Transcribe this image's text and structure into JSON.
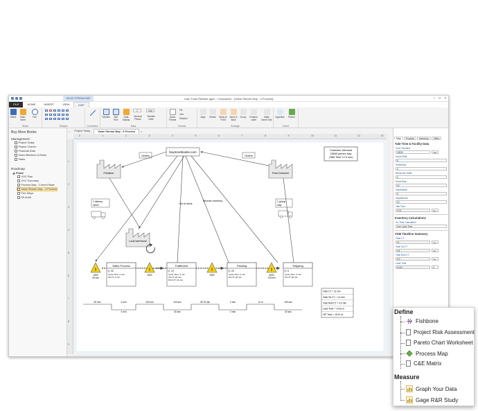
{
  "window": {
    "title": "Lean Tools Release.qgxo - Companion - [Value Stream Map - 4 Process]",
    "context_tab": "VALUE STREAM MAP",
    "controls": [
      "–",
      "□",
      "×"
    ],
    "help": "?"
  },
  "ribbon_tabs": [
    "FILE",
    "HOME",
    "INSERT",
    "VIEW",
    "MAP"
  ],
  "ribbon": {
    "mode": {
      "label": "Mode",
      "buttons": [
        "Select",
        "Multi-Insert",
        "Pan"
      ]
    },
    "shapes": {
      "label": "Shapes"
    },
    "connector": {
      "label": "Connector"
    },
    "data": {
      "label": "Data",
      "buttons": [
        "Timeline",
        "Takt Time",
        "Data Display",
        "Decimal Places",
        "Timeline Units"
      ],
      "decimal_value": "2",
      "auto_label": "Auto"
    },
    "format": {
      "label": "Format",
      "buttons": [
        "Quick Format",
        "Fill",
        "Line",
        "Shadow"
      ]
    },
    "arrange": {
      "label": "Arrange",
      "buttons": [
        "Align",
        "Rotate",
        "Bring to Front",
        "Send to Back",
        "Group",
        "Position Label",
        "Make Same Size"
      ]
    },
    "insert": {
      "label": "Insert",
      "buttons": [
        "Hyperlink",
        "Picture"
      ]
    }
  },
  "navigator": {
    "header": "Buy More Books",
    "management_label": "Management",
    "management_items": [
      "Project Today",
      "Project Charter",
      "Financial Data",
      "Team Members & Roles",
      "Tasks"
    ],
    "roadmap_label": "Roadmap",
    "phase_label": "Phase",
    "phase_items": [
      "VOC Plan",
      "VOC Summary",
      "Process Map - Current State",
      "Value Stream Map - 4 Process",
      "Five Whys",
      "5S Audit"
    ],
    "selected_item": "Value Stream Map - 4 Process"
  },
  "doc_tabs": [
    "Project Today",
    "Value Stream Map - 4 Process"
  ],
  "ruler_top": [
    "0",
    "1",
    "2",
    "3",
    "4",
    "5",
    "6",
    "7",
    "8",
    "9",
    "10",
    "11",
    "12",
    "13"
  ],
  "ruler_left": [
    "1",
    "2",
    "3",
    "4",
    "5",
    "6",
    "7",
    "8",
    "9"
  ],
  "vsm": {
    "customer_website": "buymorebooks.com",
    "orders_left": "Orders",
    "orders_right": "Orders",
    "publisher": "Publisher",
    "final_customer": "Final Customer",
    "customer_demand": [
      "Customer Demand",
      "15000 pieces /day",
      "(Takt Time 3.74 sec)"
    ],
    "delivery_left": [
      "1 delivery",
      "/week"
    ],
    "delivery_right": [
      "1 pickup",
      "/day"
    ],
    "local_warehouse": "Local warehouse",
    "out_of_stock": "Out of stock",
    "reorder_inventory": "Reorder inventory",
    "processes": [
      {
        "name": "Sales Process",
        "operators": "42",
        "data": [
          "Cycle Time: 4 min",
          "VA CT: 3 min"
        ]
      },
      {
        "name": "Fulfillment",
        "operators": "10",
        "data": [
          "Cycle Time: 2 min",
          "VA CT: 20 min",
          "NVA CT: 14 min"
        ]
      },
      {
        "name": "Packing",
        "operators": "20",
        "data": [
          "Cycle Time: 2 min",
          "VA CT: 20 min"
        ]
      },
      {
        "name": "Shipping",
        "operators": "5",
        "data": [
          "Cycle Time: 2 min",
          "VA CT: 60 min"
        ]
      }
    ],
    "inventory": [
      {
        "value": "1600",
        "time": "90 min"
      },
      {
        "value": "1600"
      },
      {
        "value": "1600"
      },
      {
        "value": "5400",
        "time": "720 min"
      }
    ],
    "timeline_top": [
      "90 min",
      "4 min",
      "100 min",
      "120 sec",
      "33.75 min",
      "2 min",
      "12 m",
      "120 sec"
    ],
    "timeline_bottom": [
      "3 min",
      "30 sec",
      "2 min",
      "30 sec"
    ],
    "summary": [
      "Total CT = 11 min",
      "Total VA CT = 4.4 min",
      "Total NVA CT = 4.0 min",
      "Lead Time = 14.61 hr",
      "VIP Time = 15.41 hr"
    ]
  },
  "task_pane": {
    "tabs": [
      "Map",
      "Process",
      "Inventory",
      "Other"
    ],
    "takt_section": "Takt Time & Facility Data",
    "cust_demand_label": "Cust. Demand",
    "cust_demand_value": "15000",
    "cust_demand_unit": "/day",
    "fields": [
      {
        "label": "Hours/Shift",
        "value": "8"
      },
      {
        "label": "Shifts/Day",
        "value": "3"
      },
      {
        "label": "Break Min./Shift",
        "value": "0"
      },
      {
        "label": "Hours/Day",
        "value": "24"
      },
      {
        "label": "Days/Week",
        "value": "5"
      },
      {
        "label": "Days/Month",
        "value": "20"
      }
    ],
    "takt_label": "Takt Time",
    "takt_value": "3.74",
    "takt_unit": "sec",
    "inventory_section": "Inventory Calculations",
    "inv_time_label": "Inv Time Calculation",
    "inv_time_value": "Use Cycle Time",
    "timeline_section": "VSM Timeline Summary",
    "summary_fields": [
      {
        "label": "Total CT",
        "value": "11",
        "unit": "min"
      },
      {
        "label": "Total VA CT",
        "value": "4.4",
        "unit": "min"
      },
      {
        "label": "Total NVA CT",
        "value": "4.0",
        "unit": "min"
      },
      {
        "label": "Lead Time",
        "value": "14.61",
        "unit": "hr"
      }
    ]
  },
  "popup": {
    "define_label": "Define",
    "define_items": [
      "Fishbone",
      "Project Risk Assessment",
      "Pareto Chart Worksheet",
      "Process Map",
      "C&E Matrix"
    ],
    "measure_label": "Measure",
    "measure_items": [
      "Graph Your Data",
      "Gage R&R Study"
    ]
  }
}
